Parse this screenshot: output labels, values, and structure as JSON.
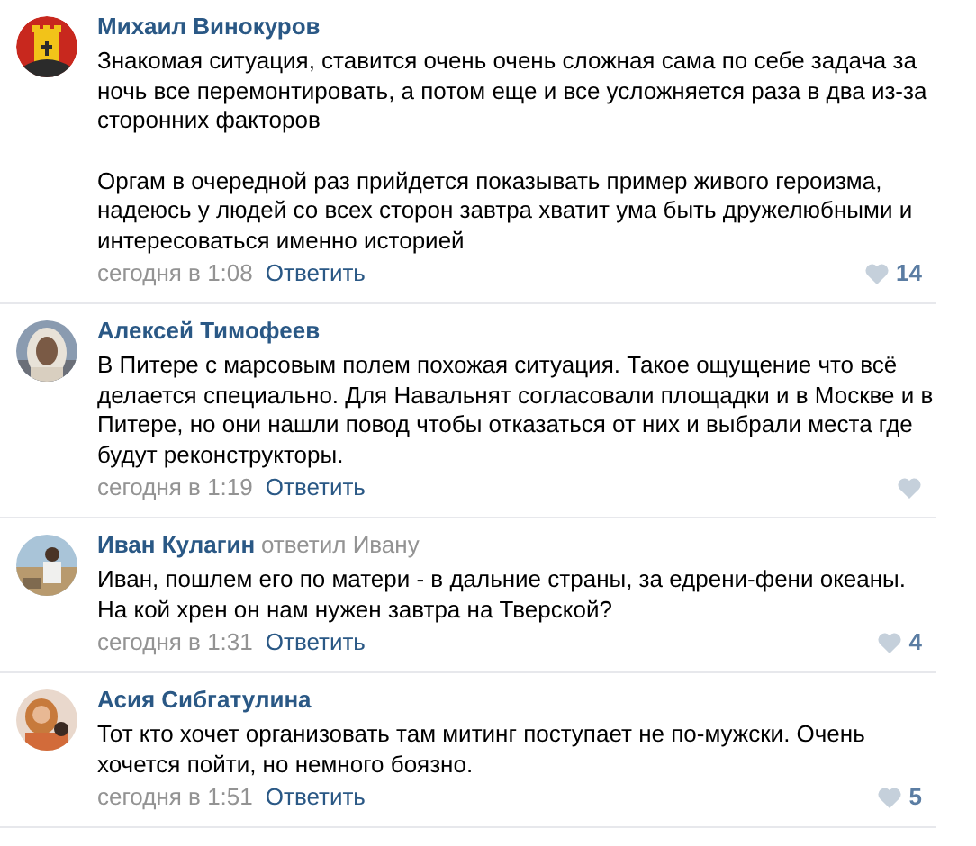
{
  "comments": [
    {
      "author": "Михаил Винокуров",
      "paragraphs": [
        "Знакомая ситуация, ставится очень очень сложная сама по себе задача за ночь все перемонтировать, а потом еще и все усложняется раза в два из-за сторонних факторов",
        "Оргам в очередной раз прийдется показывать пример живого героизма, надеюсь у людей со всех сторон завтра хватит ума быть дружелюбными и интересоваться именно историей"
      ],
      "time": "сегодня в 1:08",
      "reply": "Ответить",
      "likes": "14"
    },
    {
      "author": "Алексей Тимофеев",
      "paragraphs": [
        "В Питере с марсовым полем похожая ситуация. Такое ощущение что всё делается специально. Для Навальнят согласовали площадки и в Москве и в Питере, но они нашли повод чтобы отказаться от них и выбрали места где будут реконструкторы."
      ],
      "time": "сегодня в 1:19",
      "reply": "Ответить"
    },
    {
      "author": "Иван Кулагин",
      "reply_to": "ответил Ивану",
      "paragraphs": [
        "Иван, пошлем его по матери - в дальние страны, за едрени-фени океаны. На кой хрен он нам нужен завтра на Тверской?"
      ],
      "time": "сегодня в 1:31",
      "reply": "Ответить",
      "likes": "4"
    },
    {
      "author": "Асия Сибгатулина",
      "paragraphs": [
        "Тот кто хочет организовать там митинг поступает не по-мужски. Очень хочется пойти, но немного боязно."
      ],
      "time": "сегодня в 1:51",
      "reply": "Ответить",
      "likes": "5"
    }
  ]
}
